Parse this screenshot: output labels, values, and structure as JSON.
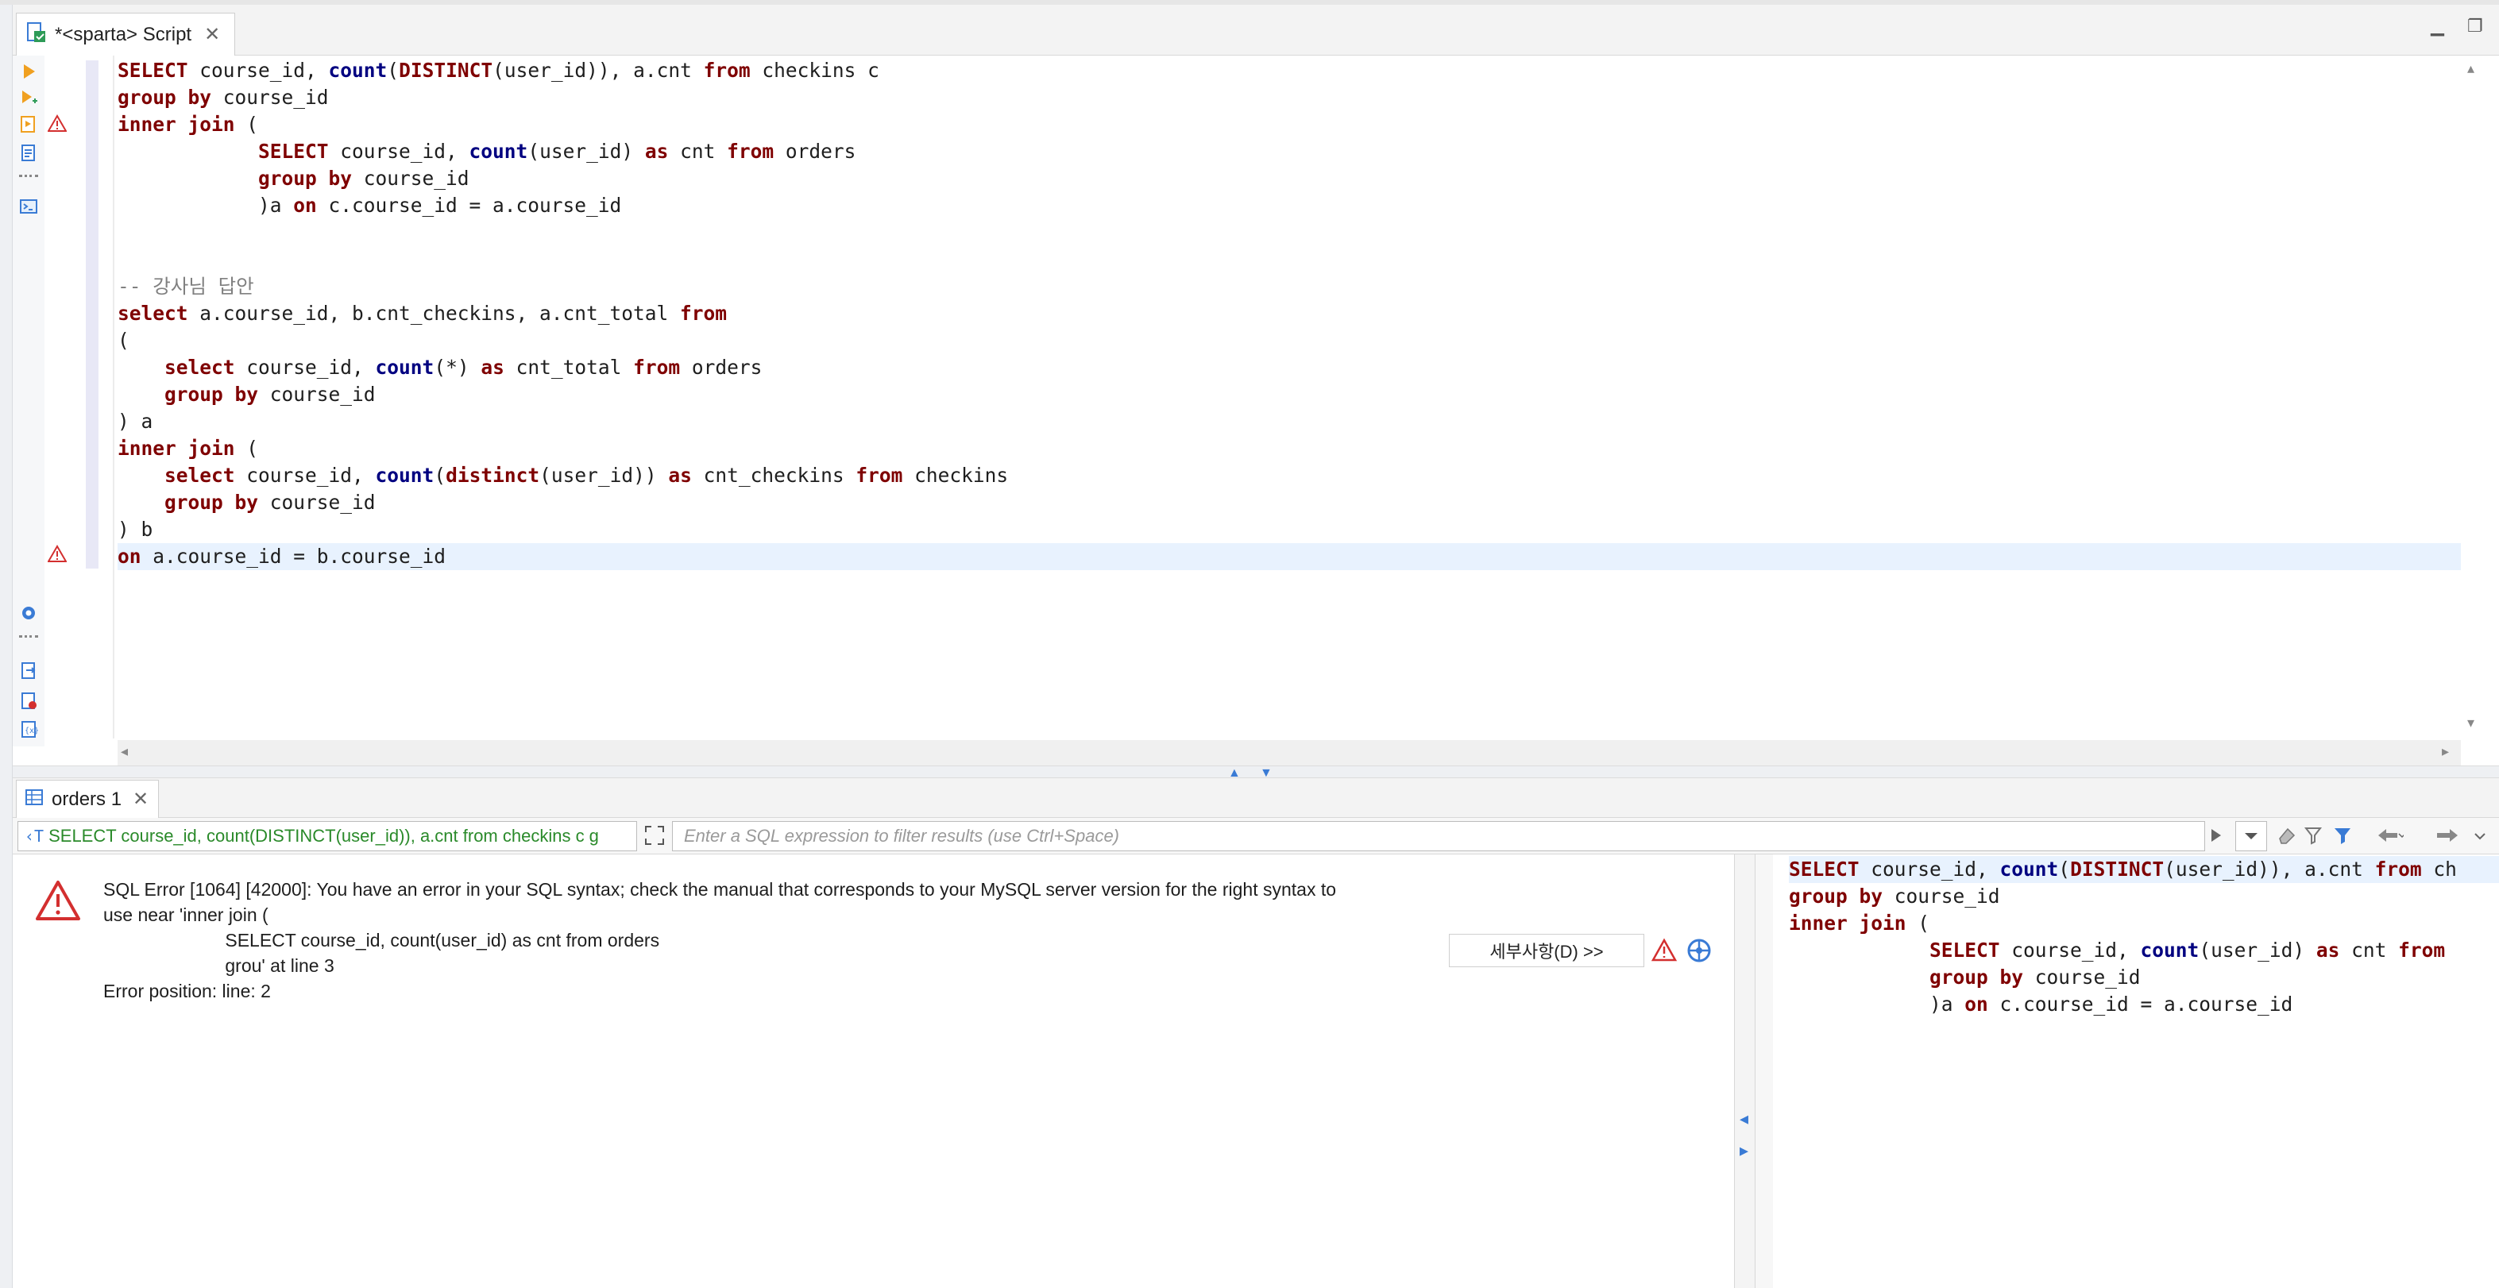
{
  "editor_tab": {
    "title": "*<sparta> Script"
  },
  "editor": {
    "lines": [
      [
        [
          "kw",
          "SELECT"
        ],
        [
          "t",
          " course_id, "
        ],
        [
          "fn",
          "count"
        ],
        [
          "t",
          "("
        ],
        [
          "kw",
          "DISTINCT"
        ],
        [
          "t",
          "(user_id)), a.cnt "
        ],
        [
          "kw",
          "from"
        ],
        [
          "t",
          " checkins c"
        ]
      ],
      [
        [
          "kw",
          "group by"
        ],
        [
          "t",
          " course_id"
        ]
      ],
      [
        [
          "kw",
          "inner join"
        ],
        [
          "t",
          " ("
        ]
      ],
      [
        [
          "t",
          "            "
        ],
        [
          "kw",
          "SELECT"
        ],
        [
          "t",
          " course_id, "
        ],
        [
          "fn",
          "count"
        ],
        [
          "t",
          "(user_id) "
        ],
        [
          "kw",
          "as"
        ],
        [
          "t",
          " cnt "
        ],
        [
          "kw",
          "from"
        ],
        [
          "t",
          " orders"
        ]
      ],
      [
        [
          "t",
          "            "
        ],
        [
          "kw",
          "group by"
        ],
        [
          "t",
          " course_id"
        ]
      ],
      [
        [
          "t",
          "            )a "
        ],
        [
          "kw",
          "on"
        ],
        [
          "t",
          " c.course_id = a.course_id"
        ]
      ],
      [],
      [],
      [
        [
          "cm",
          "-- 강사님 답안"
        ]
      ],
      [
        [
          "kw",
          "select"
        ],
        [
          "t",
          " a.course_id, b.cnt_checkins, a.cnt_total "
        ],
        [
          "kw",
          "from"
        ]
      ],
      [
        [
          "t",
          "("
        ]
      ],
      [
        [
          "t",
          "    "
        ],
        [
          "kw",
          "select"
        ],
        [
          "t",
          " course_id, "
        ],
        [
          "fn",
          "count"
        ],
        [
          "t",
          "(*) "
        ],
        [
          "kw",
          "as"
        ],
        [
          "t",
          " cnt_total "
        ],
        [
          "kw",
          "from"
        ],
        [
          "t",
          " orders"
        ]
      ],
      [
        [
          "t",
          "    "
        ],
        [
          "kw",
          "group by"
        ],
        [
          "t",
          " course_id"
        ]
      ],
      [
        [
          "t",
          ") a"
        ]
      ],
      [
        [
          "kw",
          "inner join"
        ],
        [
          "t",
          " ("
        ]
      ],
      [
        [
          "t",
          "    "
        ],
        [
          "kw",
          "select"
        ],
        [
          "t",
          " course_id, "
        ],
        [
          "fn",
          "count"
        ],
        [
          "t",
          "("
        ],
        [
          "kw",
          "distinct"
        ],
        [
          "t",
          "(user_id)) "
        ],
        [
          "kw",
          "as"
        ],
        [
          "t",
          " cnt_checkins "
        ],
        [
          "kw",
          "from"
        ],
        [
          "t",
          " checkins"
        ]
      ],
      [
        [
          "t",
          "    "
        ],
        [
          "kw",
          "group by"
        ],
        [
          "t",
          " course_id"
        ]
      ],
      [
        [
          "t",
          ") b"
        ]
      ],
      [
        [
          "kw",
          "on"
        ],
        [
          "t",
          " a.course_id = b.course_id"
        ]
      ]
    ],
    "error_marker_lines": [
      3,
      19
    ],
    "current_line": 19
  },
  "results_tab": {
    "title": "orders 1"
  },
  "filter": {
    "query_chip": "SELECT course_id, count(DISTINCT(user_id)), a.cnt from checkins c g",
    "placeholder": "Enter a SQL expression to filter results (use Ctrl+Space)"
  },
  "error": {
    "message": "SQL Error [1064] [42000]: You have an error in your SQL syntax; check the manual that corresponds to your MySQL server version for the right syntax to\nuse near 'inner join (\n                        SELECT course_id, count(user_id) as cnt from orders\n                        grou' at line 3\nError position: line: 2",
    "details_button": "세부사항(D) >>"
  },
  "query_pane": {
    "lines": [
      [
        [
          "kw",
          "SELECT"
        ],
        [
          "t",
          " course_id, "
        ],
        [
          "fn",
          "count"
        ],
        [
          "t",
          "("
        ],
        [
          "kw",
          "DISTINCT"
        ],
        [
          "t",
          "(user_id)), a.cnt "
        ],
        [
          "kw",
          "from"
        ],
        [
          "t",
          " ch"
        ]
      ],
      [
        [
          "kw",
          "group by"
        ],
        [
          "t",
          " course_id"
        ]
      ],
      [
        [
          "kw",
          "inner join"
        ],
        [
          "t",
          " ("
        ]
      ],
      [
        [
          "t",
          "            "
        ],
        [
          "kw",
          "SELECT"
        ],
        [
          "t",
          " course_id, "
        ],
        [
          "fn",
          "count"
        ],
        [
          "t",
          "(user_id) "
        ],
        [
          "kw",
          "as"
        ],
        [
          "t",
          " cnt "
        ],
        [
          "kw",
          "from"
        ]
      ],
      [
        [
          "t",
          "            "
        ],
        [
          "kw",
          "group by"
        ],
        [
          "t",
          " course_id"
        ]
      ],
      [
        [
          "t",
          "            )a "
        ],
        [
          "kw",
          "on"
        ],
        [
          "t",
          " c.course_id = a.course_id"
        ]
      ]
    ]
  },
  "colors": {
    "keyword": "#7f0000",
    "function": "#000080",
    "comment": "#808080",
    "query_chip": "#2a8a2a",
    "accent": "#3a7bd5",
    "error_red": "#d32f2f"
  }
}
